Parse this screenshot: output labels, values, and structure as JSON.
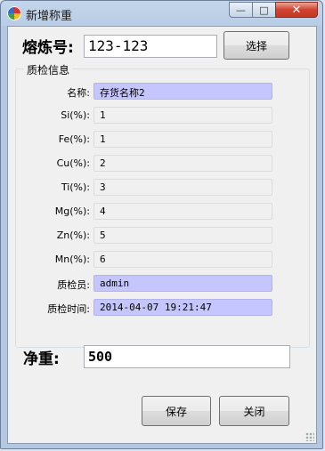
{
  "window": {
    "title": "新增称重",
    "controls": {
      "minimize": "—",
      "maximize": "□",
      "close": "✕"
    }
  },
  "melt": {
    "label": "熔炼号:",
    "value": "123-123",
    "select_button": "选择"
  },
  "group": {
    "title": "质检信息",
    "rows": [
      {
        "label": "名称:",
        "value": "存货名称2",
        "highlight": true
      },
      {
        "label": "Si(%):",
        "value": "1",
        "highlight": false
      },
      {
        "label": "Fe(%):",
        "value": "1",
        "highlight": false
      },
      {
        "label": "Cu(%):",
        "value": "2",
        "highlight": false
      },
      {
        "label": "Ti(%):",
        "value": "3",
        "highlight": false
      },
      {
        "label": "Mg(%):",
        "value": "4",
        "highlight": false
      },
      {
        "label": "Zn(%):",
        "value": "5",
        "highlight": false
      },
      {
        "label": "Mn(%):",
        "value": "6",
        "highlight": false
      },
      {
        "label": "质检员:",
        "value": "admin",
        "highlight": true
      },
      {
        "label": "质检时间:",
        "value": "2014-04-07 19:21:47",
        "highlight": true
      }
    ]
  },
  "net_weight": {
    "label": "净重:",
    "value": "500"
  },
  "buttons": {
    "save": "保存",
    "close": "关闭"
  },
  "colors": {
    "highlight_field": "#c6c6ff",
    "title_bar": "#c3d5ea",
    "close_button": "#d1422f"
  }
}
